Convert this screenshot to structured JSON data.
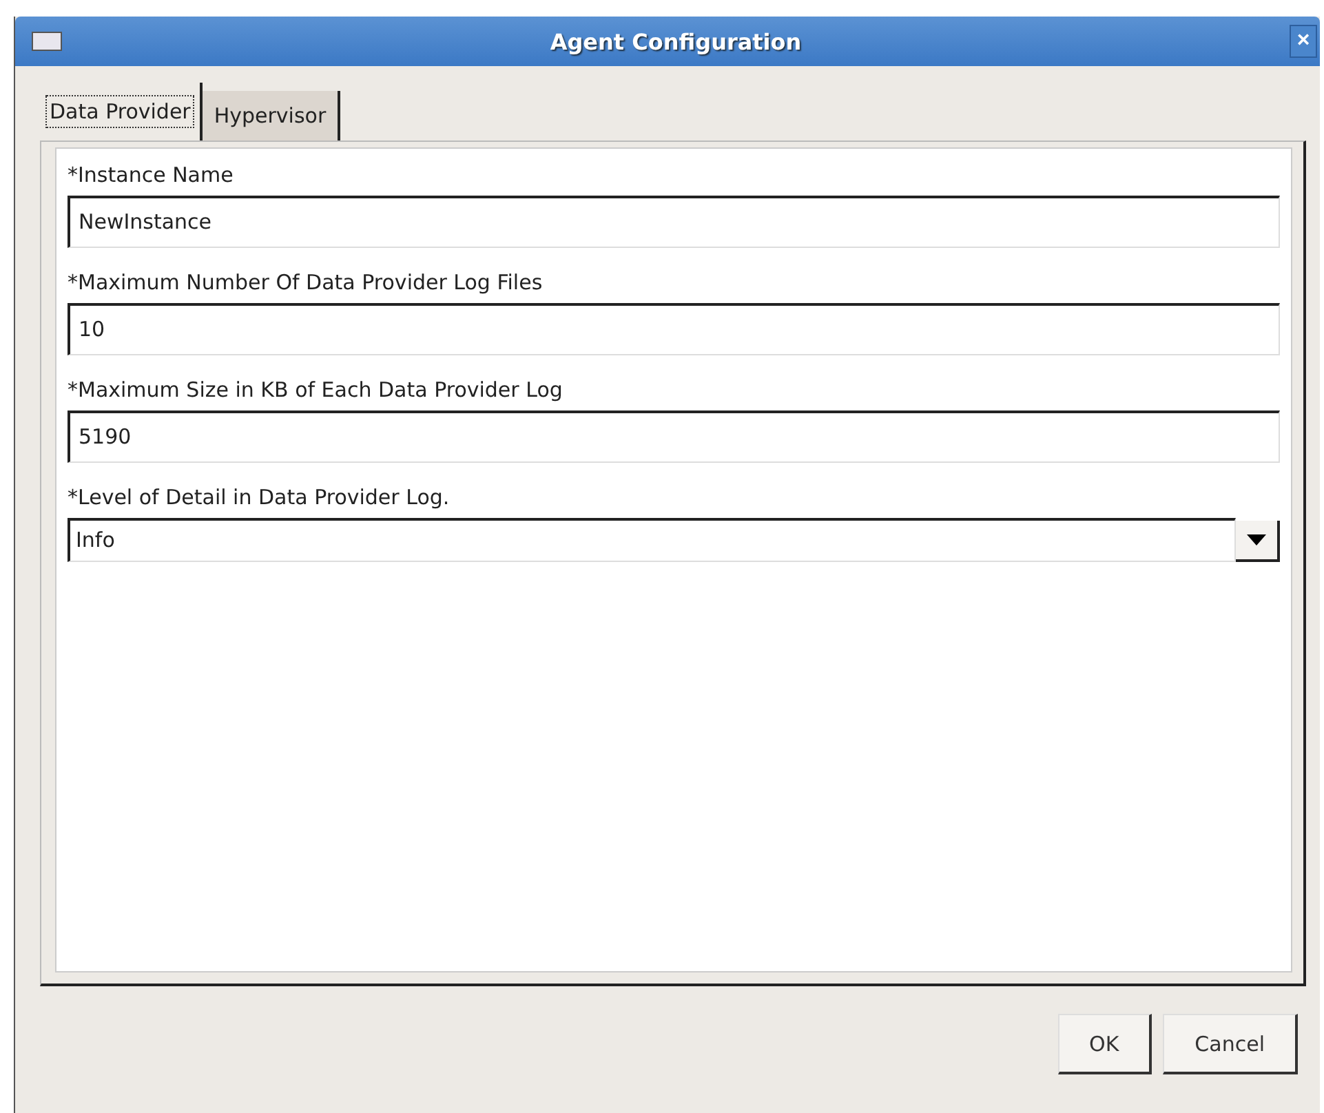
{
  "window": {
    "title": "Agent Configuration",
    "close": "×"
  },
  "tabs": [
    {
      "label": "Data Provider",
      "selected": true
    },
    {
      "label": "Hypervisor",
      "selected": false
    }
  ],
  "fields": [
    {
      "kind": "text",
      "label": "*Instance Name",
      "value": "NewInstance"
    },
    {
      "kind": "text",
      "label": "*Maximum Number Of Data Provider Log Files",
      "value": "10"
    },
    {
      "kind": "text",
      "label": "*Maximum Size in KB of Each Data Provider Log",
      "value": "5190"
    },
    {
      "kind": "select",
      "label": "*Level of Detail in Data Provider Log.",
      "value": "Info"
    }
  ],
  "buttons": [
    "OK",
    "Cancel"
  ]
}
